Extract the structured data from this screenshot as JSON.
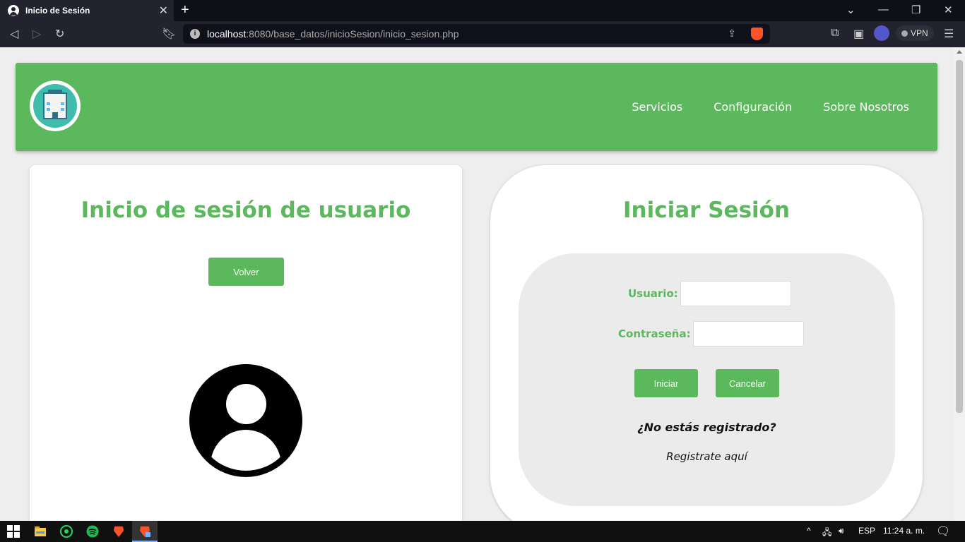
{
  "browser": {
    "tab_title": "Inicio de Sesión",
    "tab_close": "✕",
    "new_tab": "+",
    "url_host": "localhost",
    "url_rest": ":8080/base_datos/inicioSesion/inicio_sesion.php",
    "vpn_label": "VPN",
    "win_minimize": "—",
    "win_restore": "❐",
    "win_close": "✕",
    "chevron": "⌄"
  },
  "header": {
    "nav": [
      "Servicios",
      "Configuración",
      "Sobre Nosotros"
    ]
  },
  "left_card": {
    "title": "Inicio de sesión de usuario",
    "back_button": "Volver"
  },
  "right_card": {
    "title": "Iniciar Sesión",
    "user_label": "Usuario:",
    "user_value": "",
    "password_label": "Contraseña:",
    "password_value": "",
    "login_button": "Iniciar",
    "cancel_button": "Cancelar",
    "not_registered": "¿No estás registrado?",
    "register_link": "Registrate aquí"
  },
  "taskbar": {
    "language": "ESP",
    "time": "11:24 a. m."
  },
  "colors": {
    "accent": "#5cb85c",
    "form_bg": "#ebebeb"
  }
}
